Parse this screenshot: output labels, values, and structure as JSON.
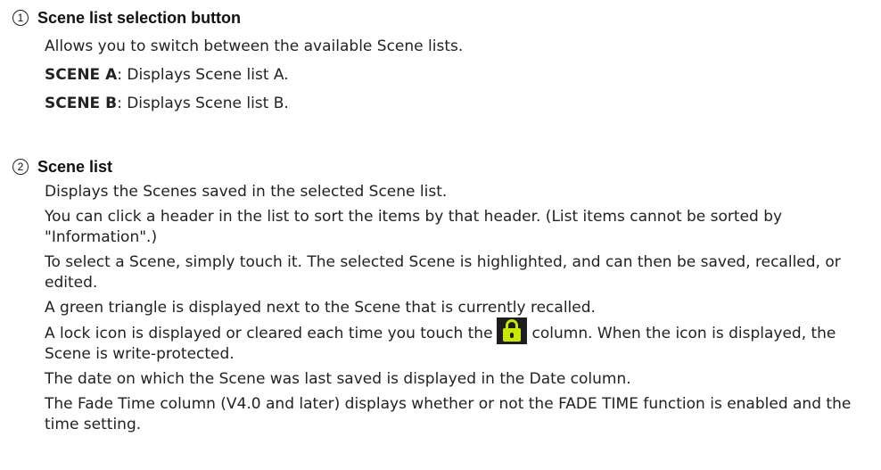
{
  "sections": [
    {
      "number": "1",
      "title": "Scene list selection button",
      "intro": "Allows you to switch between the available Scene lists.",
      "definitions": [
        {
          "term": "SCENE A",
          "desc": ": Displays Scene list A."
        },
        {
          "term": "SCENE B",
          "desc": ": Displays Scene list B."
        }
      ]
    },
    {
      "number": "2",
      "title": "Scene list",
      "paragraphs": [
        "Displays the Scenes saved in the selected Scene list.",
        "You can click a header in the list to sort the items by that header. (List items cannot be sorted by \"Information\".)",
        "To select a Scene, simply touch it. The selected Scene is highlighted, and can then be saved, recalled, or edited.",
        "A green triangle is displayed next to the Scene that is currently recalled."
      ],
      "lock_paragraph": {
        "before": "A lock icon is displayed or cleared each time you touch the",
        "after": "column. When the icon is displayed, the Scene is write-protected.",
        "icon": "lock-icon"
      },
      "paragraphs_after": [
        "The date on which the Scene was last saved is displayed in the Date column.",
        "The Fade Time column (V4.0 and later) displays whether or not the FADE TIME function is enabled and the time setting."
      ]
    }
  ]
}
